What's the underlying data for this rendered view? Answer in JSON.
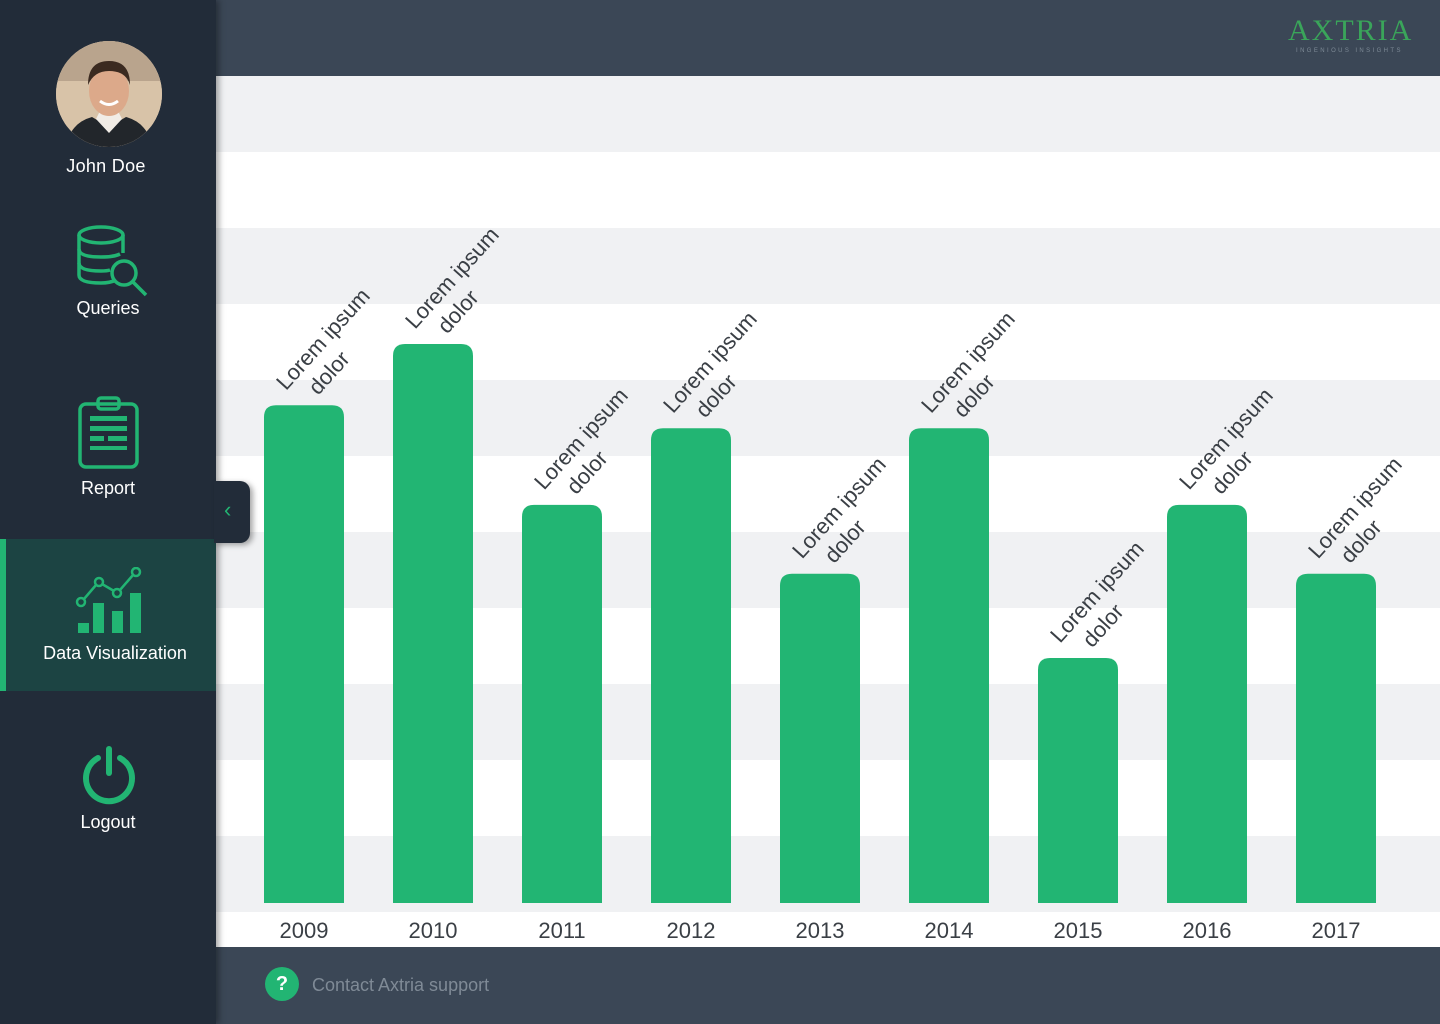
{
  "user": {
    "name": "John Doe"
  },
  "nav": {
    "queries": "Queries",
    "report": "Report",
    "data_visualization": "Data Visualization",
    "logout": "Logout"
  },
  "logo": {
    "name": "AXTRIA",
    "tagline": "INGENIOUS INSIGHTS"
  },
  "footer": {
    "help_glyph": "?",
    "support_text": "Contact Axtria support"
  },
  "collapse": {
    "glyph": "‹"
  },
  "colors": {
    "accent": "#22b573",
    "sidebar": "#222c39",
    "active_nav": "#1c4443",
    "topbar": "#3b4756",
    "stripe": "#f0f1f3"
  },
  "chart_data": {
    "type": "bar",
    "categories": [
      "2009",
      "2010",
      "2011",
      "2012",
      "2013",
      "2014",
      "2015",
      "2016",
      "2017"
    ],
    "values": [
      6.5,
      7.3,
      5.2,
      6.2,
      4.3,
      6.2,
      3.2,
      5.2,
      4.3
    ],
    "bar_labels": [
      "Lorem ipsum dolor",
      "Lorem ipsum dolor",
      "Lorem ipsum dolor",
      "Lorem ipsum dolor",
      "Lorem ipsum dolor",
      "Lorem ipsum dolor",
      "Lorem ipsum dolor",
      "Lorem ipsum dolor",
      "Lorem ipsum dolor"
    ],
    "ylim": [
      0,
      10.8
    ],
    "grid": "horizontal bands",
    "bar_color": "#22b573"
  }
}
